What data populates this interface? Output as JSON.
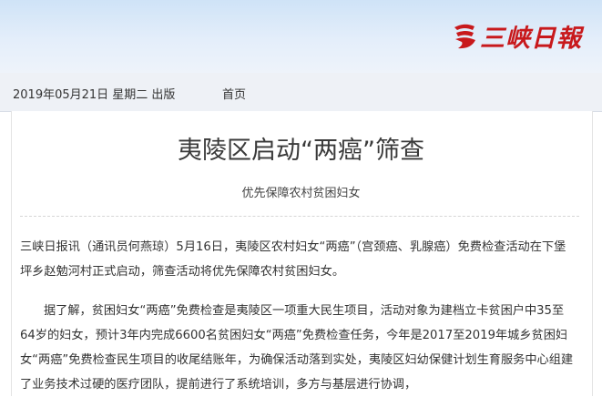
{
  "header": {
    "logo_text": "三峡日報",
    "logo_icon": "sanxia-daily-logo-icon",
    "brand_color": "#c8191c"
  },
  "navbar": {
    "date_line": "2019年05月21日  星期二  出版",
    "home_link": "首页"
  },
  "article": {
    "title": "夷陵区启动“两癌”筛查",
    "subtitle": "优先保障农村贫困妇女",
    "paragraphs": [
      "三峡日报讯（通讯员何燕琼）5月16日，夷陵区农村妇女“两癌”（宫颈癌、乳腺癌）免费检查活动在下堡坪乡赵勉河村正式启动，筛查活动将优先保障农村贫困妇女。",
      "据了解，贫困妇女“两癌”免费检查是夷陵区一项重大民生项目，活动对象为建档立卡贫困户中35至64岁的妇女，预计3年内完成6600名贫困妇女“两癌”免费检查任务，今年是2017至2019年城乡贫困妇女“两癌”免费检查民生项目的收尾结账年，为确保活动落到实处，夷陵区妇幼保健计划生育服务中心组建了业务技术过硬的医疗团队，提前进行了系统培训，多方与基层进行协调，"
    ]
  }
}
